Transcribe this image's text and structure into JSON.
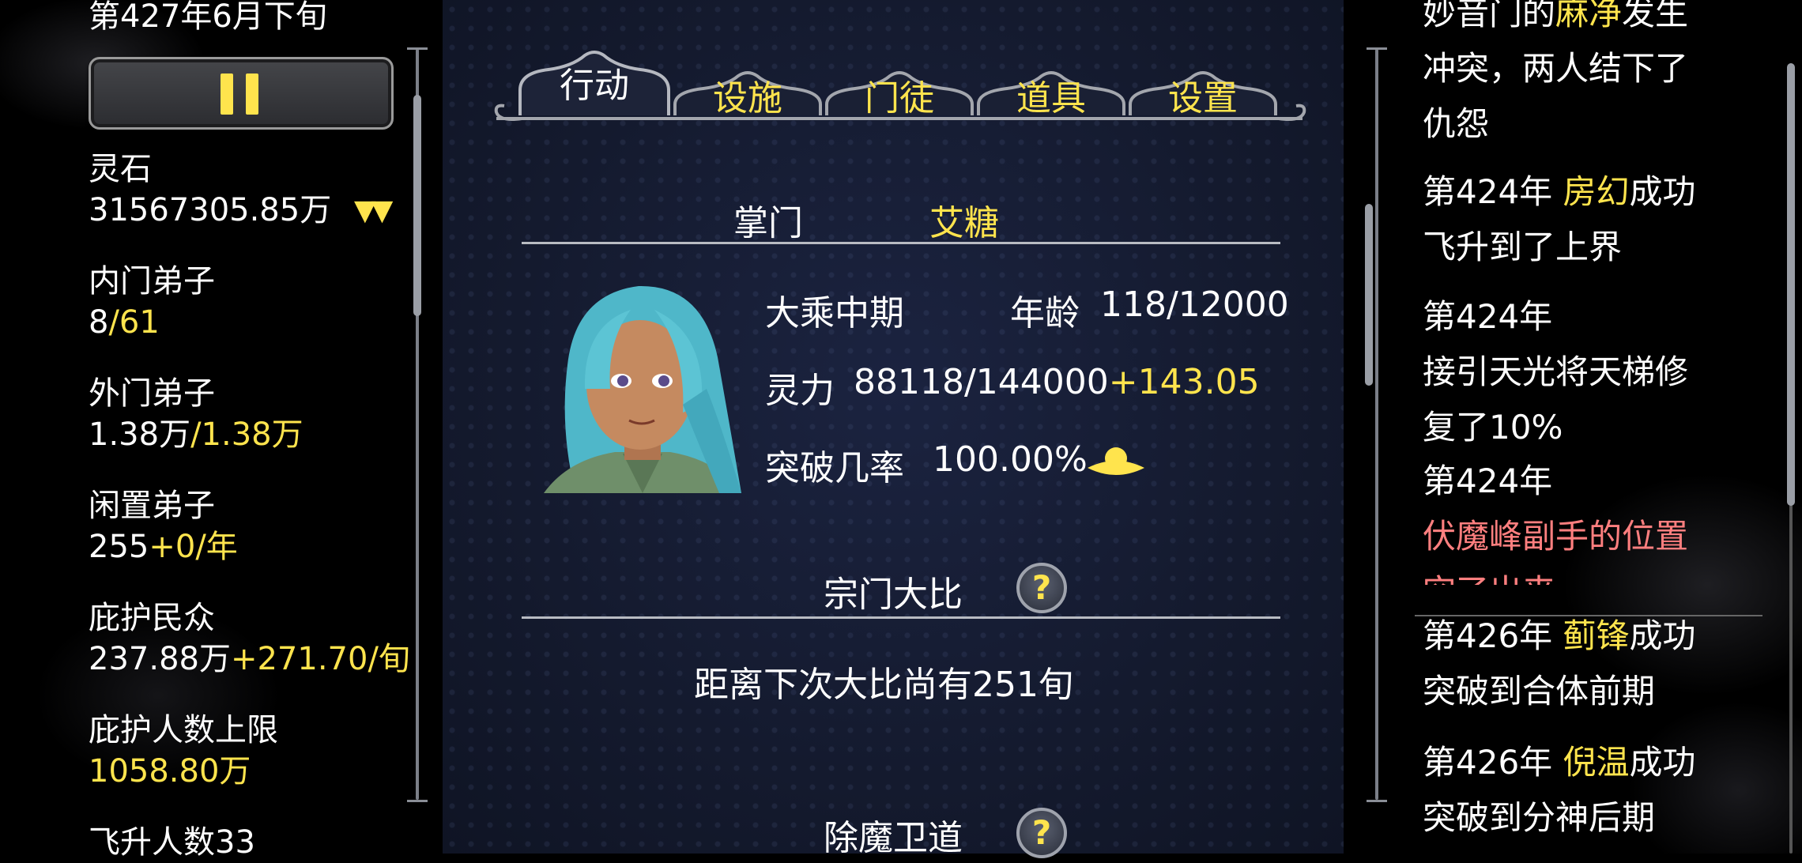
{
  "date": "第427年6月下旬",
  "pause_label": "pause",
  "resources": {
    "lingshi": {
      "label": "灵石",
      "value": "31567305.85万"
    },
    "inner": {
      "label": "内门弟子",
      "value": "8",
      "max": "/61"
    },
    "outer": {
      "label": "外门弟子",
      "value": "1.38万",
      "max": "/1.38万"
    },
    "idle": {
      "label": "闲置弟子",
      "value": "255",
      "rate": "+0/年"
    },
    "protect": {
      "label": "庇护民众",
      "value": "237.88万",
      "rate": "+271.70/旬"
    },
    "protect_max": {
      "label": "庇护人数上限",
      "value": "1058.80万"
    },
    "ascend": {
      "label": "飞升人数33"
    }
  },
  "tabs": [
    "行动",
    "设施",
    "门徒",
    "道具",
    "设置"
  ],
  "leader": {
    "title_label": "掌门",
    "name": "艾糖",
    "realm": "大乘中期",
    "age_label": "年龄",
    "age": "118/12000",
    "power_label": "灵力",
    "power": "88118/144000",
    "power_rate": "+143.05",
    "break_label": "突破几率",
    "break_rate": "100.00%"
  },
  "tournament": {
    "title": "宗门大比",
    "info": "距离下次大比尚有251旬"
  },
  "demon": {
    "title": "除魔卫道"
  },
  "help_glyph": "?",
  "log": {
    "e1": {
      "pre": "妙音门的",
      "name": "麻净",
      "post": "发生"
    },
    "e1b": "冲突，两人结下了",
    "e1c": "仇怨",
    "e2": {
      "year": "第424年 ",
      "name": "房幻",
      "post": "成功"
    },
    "e2b": "飞升到了上界",
    "e3": "第424年",
    "e3b": "接引天光将天梯修",
    "e3c": "复了10%",
    "e4": "第424年",
    "e4b": "伏魔峰副手的位置",
    "e4c": "空了出来",
    "e5": {
      "year": "第426年 ",
      "name": "蓟锋",
      "post": "成功"
    },
    "e5b": "突破到合体前期",
    "e6": {
      "year": "第426年 ",
      "name": "倪温",
      "post": "成功"
    },
    "e6b": "突破到分神后期"
  },
  "colors": {
    "accent": "#ffe44d",
    "alert": "#ff7f7f",
    "panel": "#141a2e"
  }
}
